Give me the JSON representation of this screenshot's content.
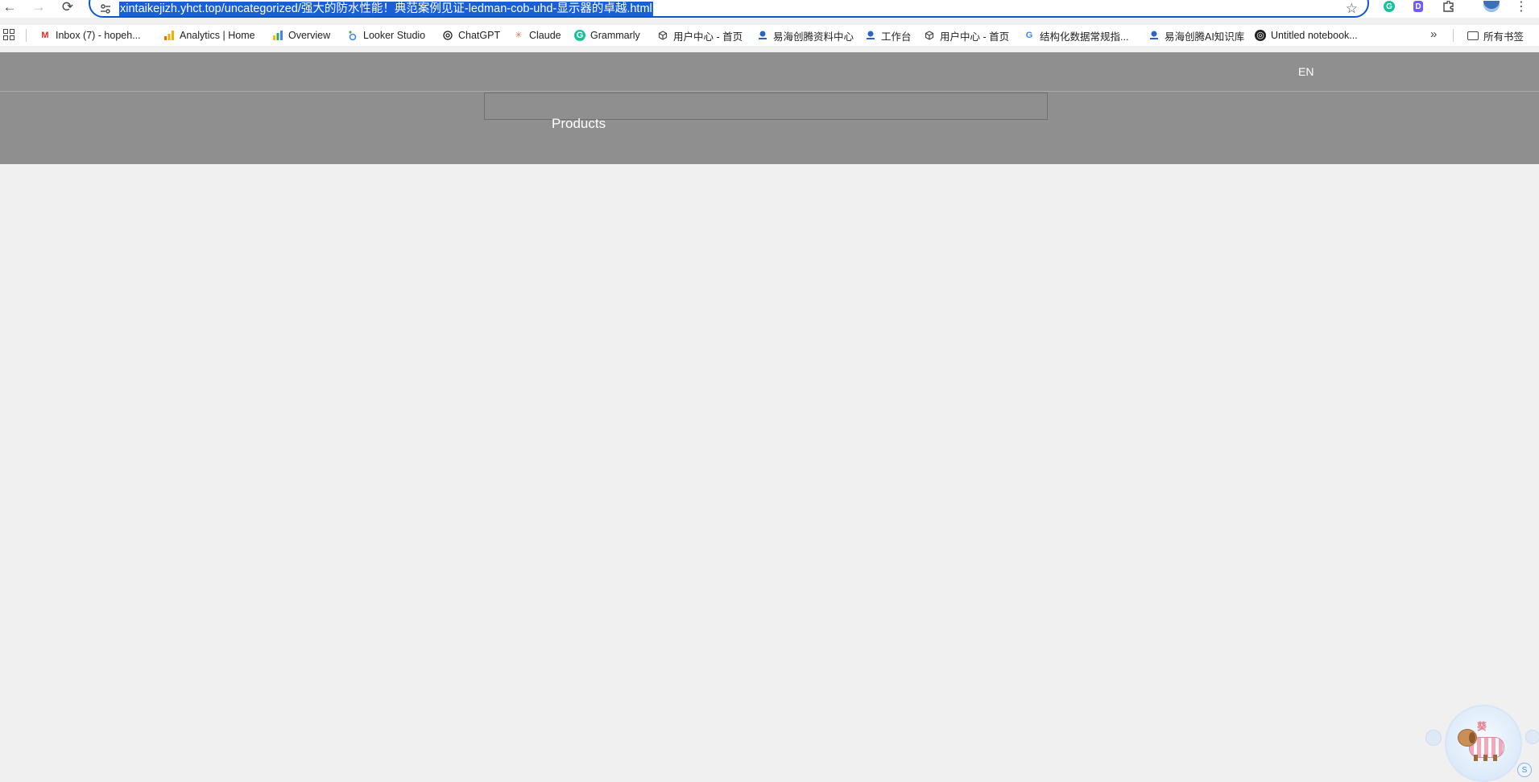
{
  "browser": {
    "back_glyph": "←",
    "forward_glyph": "→",
    "reload_glyph": "⟳",
    "url": "xintaikejizh.yhct.top/uncategorized/强大的防水性能！典范案例见证-ledman-cob-uhd-显示器的卓越.html",
    "star_glyph": "☆",
    "menu_glyph": "⋮",
    "icons": [
      "back-icon",
      "forward-icon",
      "reload-icon",
      "site-settings-icon",
      "star-icon",
      "grammarly-icon",
      "extension-d-icon",
      "puzzle-icon",
      "profile-avatar",
      "menu-icon"
    ]
  },
  "bookmarks": {
    "items": [
      {
        "label": "Inbox (7) - hopeh...",
        "icon": "gmail-icon"
      },
      {
        "label": "Analytics | Home",
        "icon": "analytics-icon"
      },
      {
        "label": "Overview",
        "icon": "overview-icon"
      },
      {
        "label": "Looker Studio",
        "icon": "looker-icon"
      },
      {
        "label": "ChatGPT",
        "icon": "chatgpt-icon"
      },
      {
        "label": "Claude",
        "icon": "claude-icon"
      },
      {
        "label": "Grammarly",
        "icon": "grammarly-icon"
      },
      {
        "label": "用户中心 - 首页",
        "icon": "cube-icon"
      },
      {
        "label": "易海创腾资料中心",
        "icon": "yihai-icon"
      },
      {
        "label": "工作台",
        "icon": "yihai-icon"
      },
      {
        "label": "用户中心 - 首页",
        "icon": "cube-icon"
      },
      {
        "label": "结构化数据常规指...",
        "icon": "google-icon"
      },
      {
        "label": "易海创腾AI知识库",
        "icon": "yihai-icon"
      },
      {
        "label": "Untitled notebook...",
        "icon": "notebook-icon"
      }
    ],
    "overflow_glyph": "»",
    "all_bookmarks_label": "所有书签"
  },
  "site": {
    "language": "EN",
    "nav_products": "Products",
    "search_placeholder": ""
  },
  "widget": {
    "mascot_text": "葵",
    "badge": "S"
  },
  "colors": {
    "header_bg": "#8f8f8f",
    "page_bg": "#f0f0f0",
    "url_highlight": "#1a5fd6",
    "omnibox_border": "#0b57d0"
  }
}
